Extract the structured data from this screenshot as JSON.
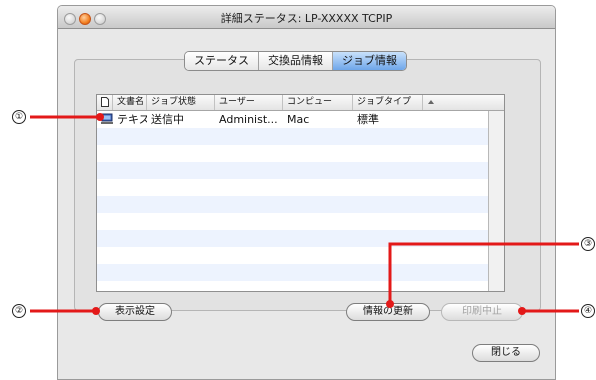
{
  "window": {
    "title": "詳細ステータス: LP-XXXXX  TCPIP"
  },
  "tabs": [
    {
      "label": "ステータス",
      "active": false
    },
    {
      "label": "交換品情報",
      "active": false
    },
    {
      "label": "ジョブ情報",
      "active": true
    }
  ],
  "job_table": {
    "columns": [
      "",
      "文書名",
      "ジョブ状態",
      "ユーザー",
      "コンピュー",
      "ジョブタイプ"
    ],
    "rows": [
      {
        "icon": "computer-icon",
        "document": "テキスト",
        "status": "送信中",
        "user": "Administ...",
        "computer": "Mac",
        "type": "標準"
      }
    ],
    "stripe_color": "#edf3fe"
  },
  "buttons": {
    "display_settings": "表示設定",
    "refresh": "情報の更新",
    "cancel_print": "印刷中止",
    "close": "閉じる"
  },
  "callouts": {
    "c1": "①",
    "c2": "②",
    "c3": "③",
    "c4": "④"
  },
  "colors": {
    "callout_line": "#e31919",
    "tab_active": "#6fa6ea"
  }
}
